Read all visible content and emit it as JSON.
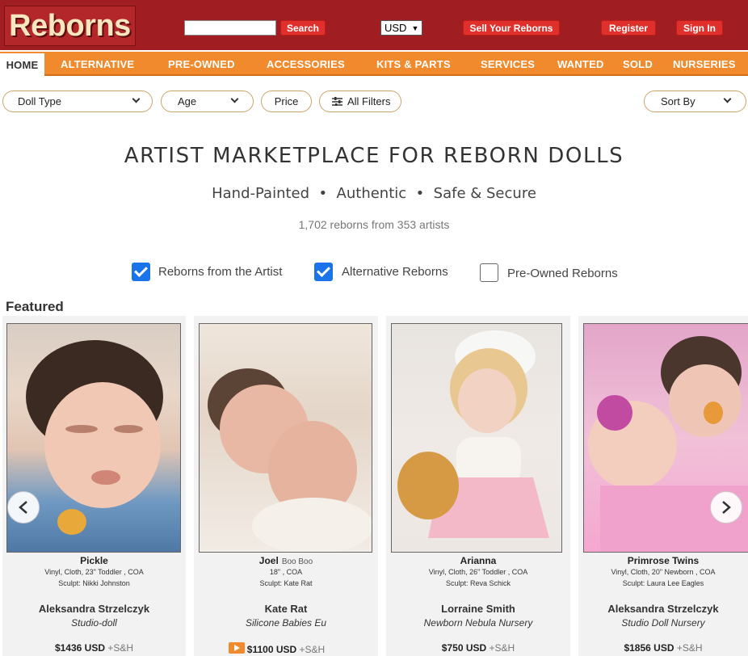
{
  "header": {
    "logo_text": "Reborns",
    "search_button": "Search",
    "currency": "USD",
    "sell_button": "Sell Your Reborns",
    "register_button": "Register",
    "signin_button": "Sign In"
  },
  "nav": {
    "items": [
      "HOME",
      "ALTERNATIVE",
      "PRE-OWNED",
      "ACCESSORIES",
      "KITS & PARTS",
      "SERVICES",
      "WANTED",
      "SOLD",
      "NURSERIES"
    ]
  },
  "filters": {
    "doll_type": "Doll Type",
    "age": "Age",
    "price": "Price",
    "all_filters": "All Filters",
    "sort_by": "Sort By"
  },
  "hero": {
    "title": "ARTIST MARKETPLACE FOR REBORN DOLLS",
    "subtitle": "Hand-Painted  •  Authentic  •  Safe & Secure",
    "count": "1,702 reborns from 353 artists"
  },
  "checkboxes": [
    {
      "label": "Reborns from the Artist",
      "checked": true
    },
    {
      "label": "Alternative Reborns",
      "checked": true
    },
    {
      "label": "Pre-Owned Reborns",
      "checked": false
    }
  ],
  "featured_heading": "Featured",
  "cards": [
    {
      "name": "Pickle",
      "alt_name": "",
      "details": "Vinyl, Cloth, 23\" Toddler , COA",
      "sculpt": "Sculpt: Nikki Johnston",
      "seller": "Aleksandra Strzelczyk",
      "shop": "Studio-doll",
      "price": "$1436 USD",
      "shipping": "+S&H"
    },
    {
      "name": "Joel",
      "alt_name": "Boo Boo",
      "details": "18\" , COA",
      "sculpt": "Sculpt: Kate Rat",
      "seller": "Kate Rat",
      "shop": "Silicone Babies Eu",
      "price": "$1100 USD",
      "shipping": "+S&H"
    },
    {
      "name": "Arianna",
      "alt_name": "",
      "details": "Vinyl, Cloth, 26\" Toddler , COA",
      "sculpt": "Sculpt: Reva Schick",
      "seller": "Lorraine Smith",
      "shop": "Newborn Nebula Nursery",
      "price": "$750 USD",
      "shipping": "+S&H"
    },
    {
      "name": "Primrose Twins",
      "alt_name": "",
      "details": "Vinyl, Cloth, 20\" Newborn , COA",
      "sculpt": "Sculpt: Laura Lee Eagles",
      "seller": "Aleksandra Strzelczyk",
      "shop": "Studio Doll Nursery",
      "price": "$1856 USD",
      "shipping": "+S&H"
    }
  ],
  "colors": {
    "header_red": "#a01e22",
    "nav_orange": "#f08a2c",
    "button_red": "#e0302c",
    "checkbox_blue": "#1a73e8"
  }
}
